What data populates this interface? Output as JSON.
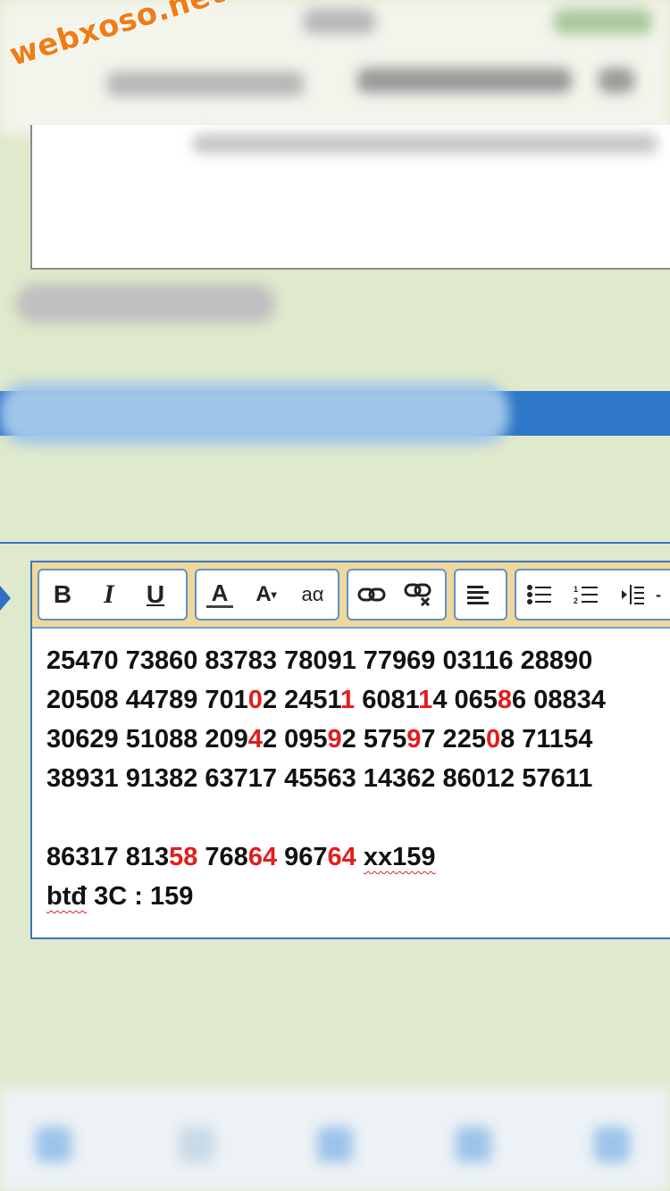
{
  "watermark": "webxoso.net",
  "toolbar": {
    "groups": [
      {
        "buttons": [
          "bold",
          "italic",
          "underline"
        ],
        "labels": {
          "bold": "B",
          "italic": "I",
          "underline": "U"
        }
      },
      {
        "buttons": [
          "text-color",
          "font-size",
          "font-style"
        ],
        "labels": {
          "text_color": "A",
          "font_size": "A",
          "font_style": "aα"
        }
      },
      {
        "buttons": [
          "insert-link",
          "remove-link"
        ]
      },
      {
        "buttons": [
          "align-left"
        ]
      },
      {
        "buttons": [
          "bullet-list",
          "numbered-list",
          "outdent"
        ]
      }
    ]
  },
  "content": {
    "line1": "25470 73860 83783 78091 77969 03116 28890",
    "line2": [
      {
        "t": "20508 44789 701"
      },
      {
        "t": "0",
        "red": true
      },
      {
        "t": "2 2451"
      },
      {
        "t": "1",
        "red": true
      },
      {
        "t": " 6081"
      },
      {
        "t": "1",
        "red": true
      },
      {
        "t": "4 065"
      },
      {
        "t": "8",
        "red": true
      },
      {
        "t": "6 08834"
      }
    ],
    "line3": [
      {
        "t": "30629 51088 209"
      },
      {
        "t": "4",
        "red": true
      },
      {
        "t": "2 095"
      },
      {
        "t": "9",
        "red": true
      },
      {
        "t": "2 575"
      },
      {
        "t": "9",
        "red": true
      },
      {
        "t": "7 225"
      },
      {
        "t": "0",
        "red": true
      },
      {
        "t": "8 71154"
      }
    ],
    "line4": "38931 91382 63717 45563 14362 86012 57611",
    "line5": [
      {
        "t": "86317 813"
      },
      {
        "t": "58",
        "red": true
      },
      {
        "t": " 768"
      },
      {
        "t": "64",
        "red": true
      },
      {
        "t": " 967"
      },
      {
        "t": "64",
        "red": true
      },
      {
        "t": " "
      },
      {
        "t": "xx159",
        "squig": true
      }
    ],
    "line6": [
      {
        "t": "btđ",
        "squig": true
      },
      {
        "t": " 3C : 159"
      }
    ]
  },
  "colors": {
    "background": "#dfe9cb",
    "accent_blue": "#3a74c2",
    "toolbar_bg": "#f0d79b",
    "highlight_red": "#e21d1d",
    "watermark_orange": "#f07d16"
  }
}
